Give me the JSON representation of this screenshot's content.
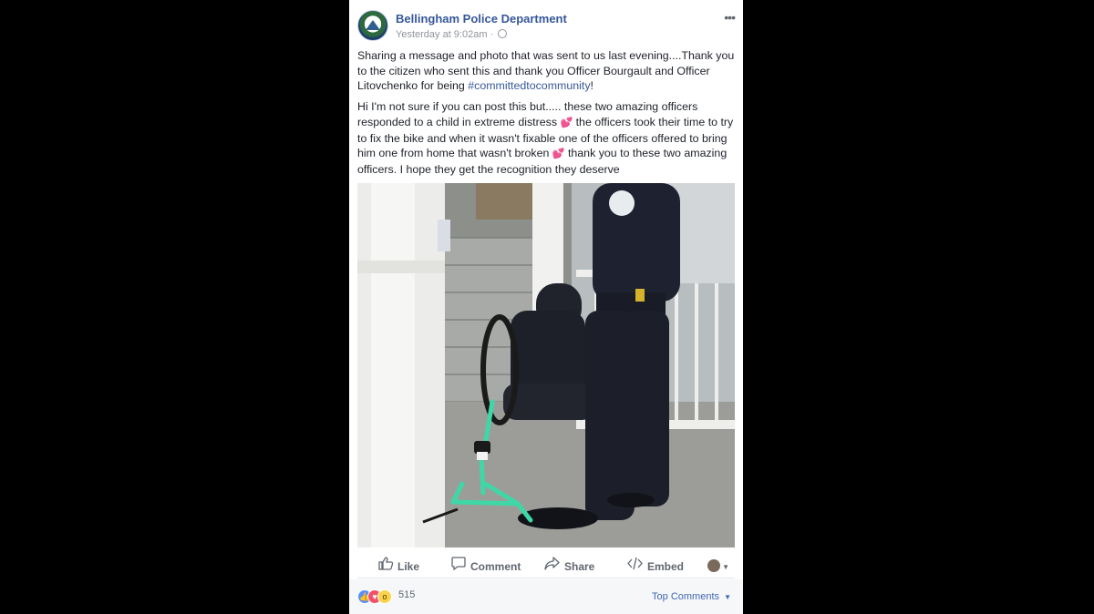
{
  "post": {
    "page_name": "Bellingham Police Department",
    "timestamp": "Yesterday at 9:02am",
    "intro_text": "Sharing a message and photo that was sent to us last evening....Thank you to the citizen who sent this and thank you Officer Bourgault and Officer Litovchenko for being ",
    "hashtag": "#committedtocommunity",
    "intro_end": "!",
    "message_part1": "Hi I'm not sure if you can post this but..... these two amazing officers responded to a child in extreme distress ",
    "message_part2": " the officers took their time to try to fix the bike and when it wasn't fixable one of the officers offered to bring him one from home that wasn't broken ",
    "message_part3": " thank you to these two amazing officers. I hope they get the recognition they deserve",
    "emoji_glyph": "💕",
    "more_glyph": "•••"
  },
  "actions": {
    "like": "Like",
    "comment": "Comment",
    "share": "Share",
    "embed": "Embed"
  },
  "footer": {
    "reaction_count": "515",
    "top_comments": "Top Comments"
  },
  "icons": {
    "like": "thumbs-up-icon",
    "comment": "comment-bubble-icon",
    "share": "share-arrow-icon",
    "embed": "code-icon",
    "globe": "globe-icon"
  },
  "colors": {
    "link": "#365899",
    "text": "#1d2129",
    "muted": "#90949c",
    "like_blue": "#5890ff",
    "love_red": "#f25268",
    "wow_yellow": "#fdd34b"
  }
}
